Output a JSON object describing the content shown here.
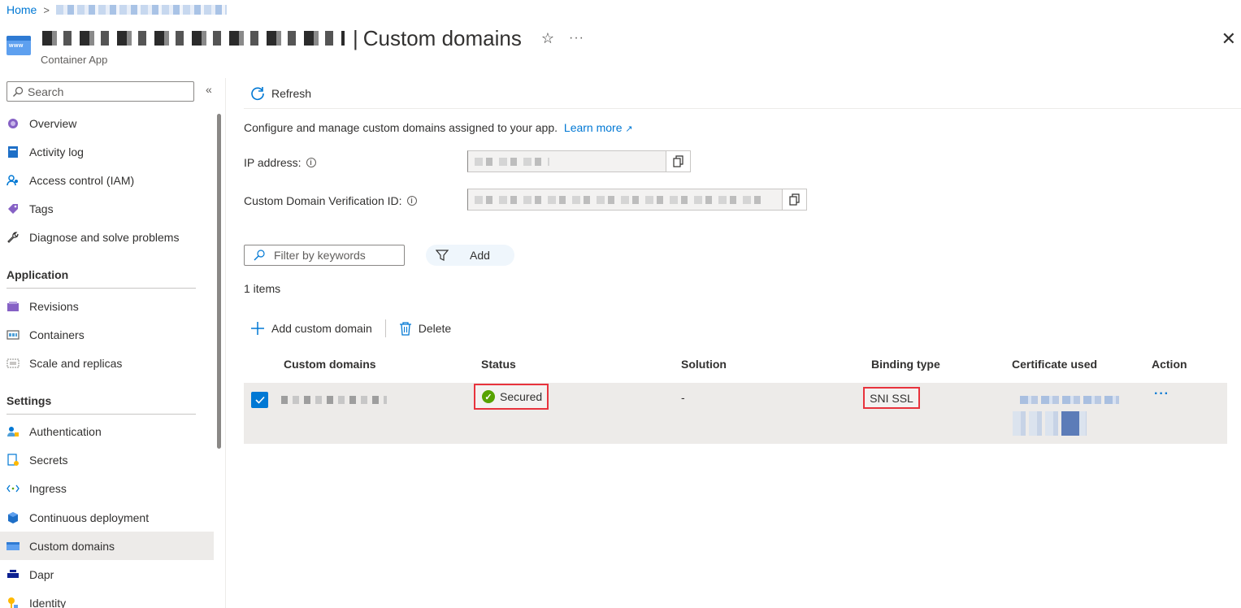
{
  "breadcrumb": {
    "home": "Home"
  },
  "header": {
    "title": "Custom domains",
    "title_separator": "|",
    "subtitle": "Container App",
    "app_icon_text": "www"
  },
  "sidebar": {
    "search_placeholder": "Search",
    "items_top": [
      {
        "label": "Overview",
        "icon": "overview-icon"
      },
      {
        "label": "Activity log",
        "icon": "activity-log-icon"
      },
      {
        "label": "Access control (IAM)",
        "icon": "iam-icon"
      },
      {
        "label": "Tags",
        "icon": "tag-icon"
      },
      {
        "label": "Diagnose and solve problems",
        "icon": "wrench-icon"
      }
    ],
    "section_application": "Application",
    "items_application": [
      {
        "label": "Revisions",
        "icon": "revisions-icon"
      },
      {
        "label": "Containers",
        "icon": "containers-icon"
      },
      {
        "label": "Scale and replicas",
        "icon": "scale-icon"
      }
    ],
    "section_settings": "Settings",
    "items_settings": [
      {
        "label": "Authentication",
        "icon": "authentication-icon"
      },
      {
        "label": "Secrets",
        "icon": "secrets-icon"
      },
      {
        "label": "Ingress",
        "icon": "ingress-icon"
      },
      {
        "label": "Continuous deployment",
        "icon": "deployment-icon"
      },
      {
        "label": "Custom domains",
        "icon": "custom-domains-icon",
        "active": true
      },
      {
        "label": "Dapr",
        "icon": "dapr-icon"
      },
      {
        "label": "Identity",
        "icon": "identity-icon"
      }
    ]
  },
  "commandbar": {
    "refresh": "Refresh"
  },
  "main": {
    "description": "Configure and manage custom domains assigned to your app.",
    "learn_more": "Learn more",
    "ip_label": "IP address:",
    "verification_label": "Custom Domain Verification ID:",
    "filter_placeholder": "Filter by keywords",
    "add_filter": "Add",
    "item_count": "1 items",
    "add_domain": "Add custom domain",
    "delete": "Delete"
  },
  "table": {
    "columns": [
      "Custom domains",
      "Status",
      "Solution",
      "Binding type",
      "Certificate used",
      "Action"
    ],
    "rows": [
      {
        "status": "Secured",
        "solution": "-",
        "binding_type": "SNI SSL",
        "action": "···"
      }
    ]
  },
  "colors": {
    "accent": "#0078d4",
    "highlight_border": "#e8333d",
    "status_ok": "#57a300",
    "active_nav": "#edebe9"
  }
}
